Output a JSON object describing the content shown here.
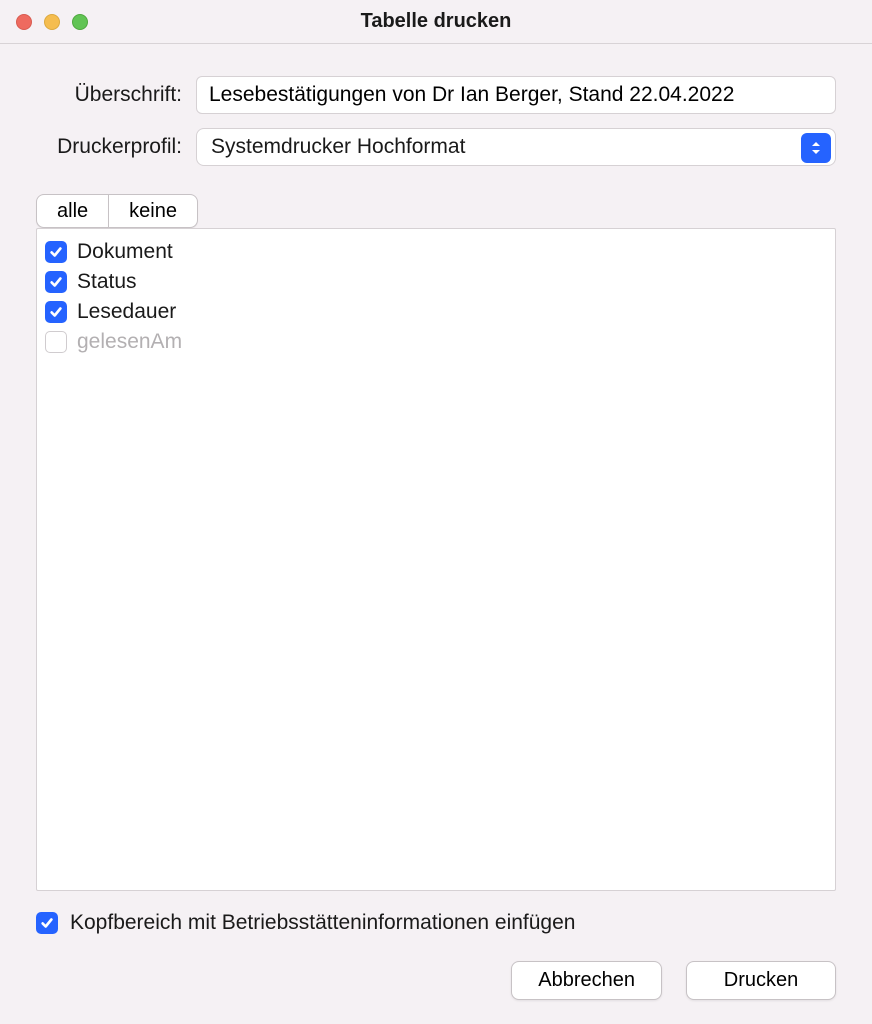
{
  "window": {
    "title": "Tabelle drucken"
  },
  "form": {
    "heading_label": "Überschrift:",
    "heading_value": "Lesebestätigungen von Dr Ian Berger, Stand 22.04.2022",
    "profile_label": "Druckerprofil:",
    "profile_value": "Systemdrucker Hochformat"
  },
  "segment": {
    "all": "alle",
    "none": "keine"
  },
  "columns": [
    {
      "label": "Dokument",
      "checked": true,
      "disabled": false
    },
    {
      "label": "Status",
      "checked": true,
      "disabled": false
    },
    {
      "label": "Lesedauer",
      "checked": true,
      "disabled": false
    },
    {
      "label": "gelesenAm",
      "checked": false,
      "disabled": true
    }
  ],
  "footer": {
    "header_info_label": "Kopfbereich mit Betriebsstätteninformationen einfügen",
    "header_info_checked": true
  },
  "buttons": {
    "cancel": "Abbrechen",
    "print": "Drucken"
  }
}
